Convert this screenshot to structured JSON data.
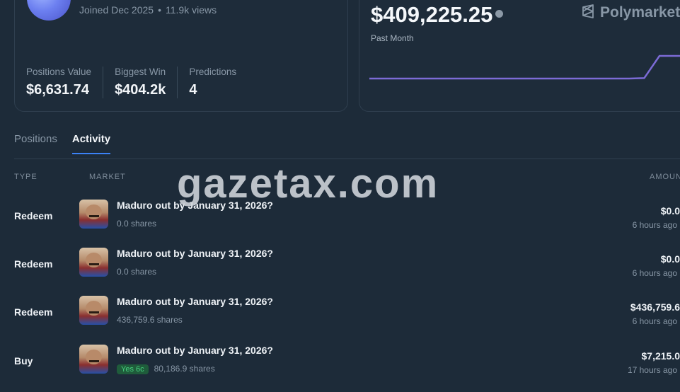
{
  "profile": {
    "joined": "Joined Dec 2025",
    "separator": "•",
    "views": "11.9k views",
    "stats": [
      {
        "label": "Positions Value",
        "value": "$6,631.74"
      },
      {
        "label": "Biggest Win",
        "value": "$404.2k"
      },
      {
        "label": "Predictions",
        "value": "4"
      }
    ]
  },
  "pnl": {
    "amount": "$409,225.25",
    "period": "Past Month",
    "brand": "Polymarket",
    "line_color": "#7c6bd6",
    "line_series": [
      0,
      0,
      0,
      0,
      0,
      0,
      0,
      0,
      0,
      0,
      0,
      0,
      0,
      0,
      0,
      0,
      0,
      0,
      0.02,
      1
    ]
  },
  "tabs": [
    {
      "label": "Positions",
      "active": false
    },
    {
      "label": "Activity",
      "active": true
    }
  ],
  "columns": {
    "type": "TYPE",
    "market": "MARKET",
    "amount": "AMOUN"
  },
  "rows": [
    {
      "type": "Redeem",
      "market": "Maduro out by January 31, 2026?",
      "shares": "0.0 shares",
      "amount": "$0.0",
      "time": "6 hours ago"
    },
    {
      "type": "Redeem",
      "market": "Maduro out by January 31, 2026?",
      "shares": "0.0 shares",
      "amount": "$0.0",
      "time": "6 hours ago"
    },
    {
      "type": "Redeem",
      "market": "Maduro out by January 31, 2026?",
      "shares": "436,759.6 shares",
      "amount": "$436,759.6",
      "time": "6 hours ago"
    },
    {
      "type": "Buy",
      "market": "Maduro out by January 31, 2026?",
      "pill": "Yes 6c",
      "shares": "80,186.9 shares",
      "amount": "$7,215.0",
      "time": "17 hours ago"
    }
  ],
  "watermark": "gazetax.com"
}
